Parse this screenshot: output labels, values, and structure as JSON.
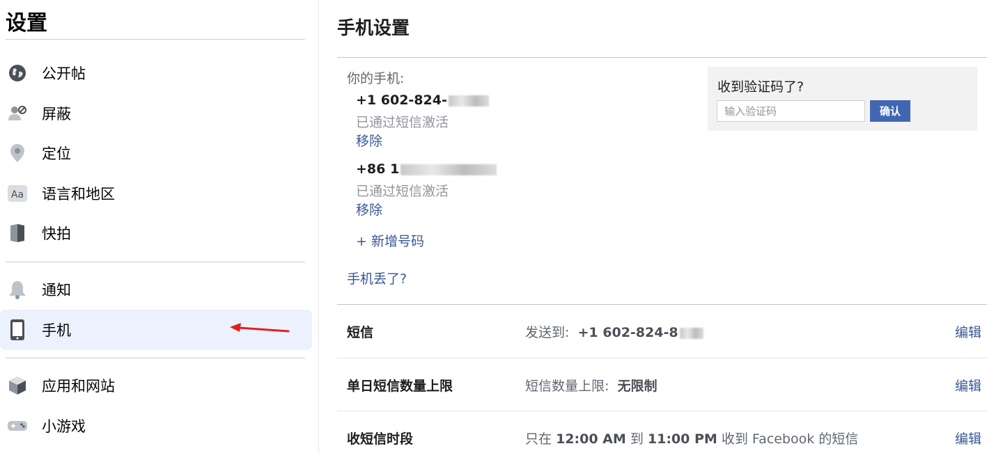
{
  "sidebar": {
    "title": "设置",
    "items": [
      {
        "label": "公开帖",
        "icon": "globe-icon"
      },
      {
        "label": "屏蔽",
        "icon": "block-user-icon"
      },
      {
        "label": "定位",
        "icon": "location-pin-icon"
      },
      {
        "label": "语言和地区",
        "icon": "language-icon"
      },
      {
        "label": "快拍",
        "icon": "stories-book-icon"
      },
      {
        "label": "通知",
        "icon": "bell-icon"
      },
      {
        "label": "手机",
        "icon": "mobile-phone-icon"
      },
      {
        "label": "应用和网站",
        "icon": "apps-cube-icon"
      },
      {
        "label": "小游戏",
        "icon": "game-controller-icon"
      }
    ],
    "active": "手机"
  },
  "main": {
    "title": "手机设置",
    "phones_label": "你的手机:",
    "phones": [
      {
        "number": "+1 602-824-",
        "status": "已通过短信激活",
        "remove": "移除"
      },
      {
        "number": "+86 1",
        "status": "已通过短信激活",
        "remove": "移除"
      }
    ],
    "add_number": "+ 新增号码",
    "lost_phone": "手机丢了?",
    "verify": {
      "title": "收到验证码了?",
      "placeholder": "输入验证码",
      "confirm": "确认"
    },
    "rows": [
      {
        "label": "短信",
        "prefix": "发送到:",
        "value": "+1 602-824-8",
        "edit": "编辑"
      },
      {
        "label": "单日短信数量上限",
        "prefix": "短信数量上限:",
        "value": "无限制",
        "edit": "编辑"
      },
      {
        "label": "收短信时段",
        "t1": "只在",
        "start": "12:00 AM",
        "t2": "到",
        "end": "11:00 PM",
        "t3": "收到 Facebook 的短信",
        "edit": "编辑"
      }
    ]
  },
  "colors": {
    "accent": "#4267b2",
    "link": "#385898",
    "active_bg": "#ebf2fd",
    "arrow": "#e02020"
  }
}
